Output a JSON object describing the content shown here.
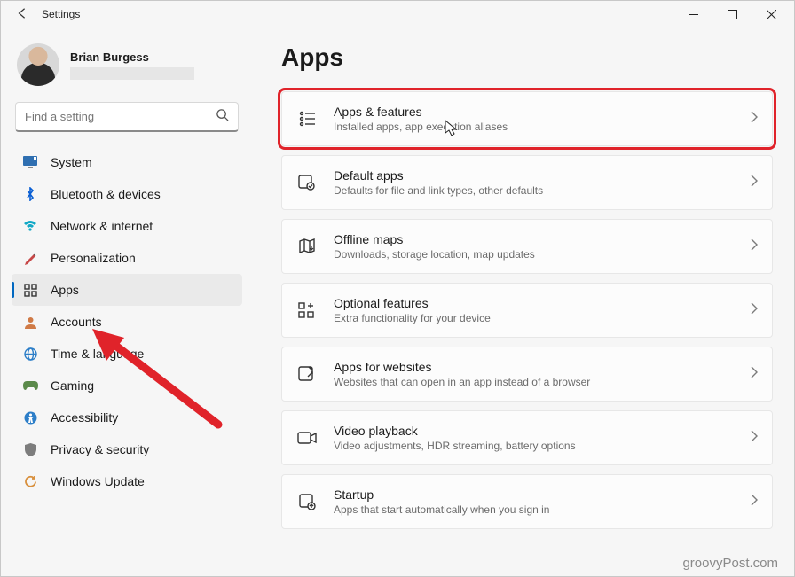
{
  "window": {
    "title": "Settings"
  },
  "profile": {
    "name": "Brian Burgess"
  },
  "search": {
    "placeholder": "Find a setting"
  },
  "sidebar": {
    "items": [
      {
        "label": "System"
      },
      {
        "label": "Bluetooth & devices"
      },
      {
        "label": "Network & internet"
      },
      {
        "label": "Personalization"
      },
      {
        "label": "Apps"
      },
      {
        "label": "Accounts"
      },
      {
        "label": "Time & language"
      },
      {
        "label": "Gaming"
      },
      {
        "label": "Accessibility"
      },
      {
        "label": "Privacy & security"
      },
      {
        "label": "Windows Update"
      }
    ]
  },
  "main": {
    "heading": "Apps",
    "cards": [
      {
        "title": "Apps & features",
        "subtitle": "Installed apps, app execution aliases"
      },
      {
        "title": "Default apps",
        "subtitle": "Defaults for file and link types, other defaults"
      },
      {
        "title": "Offline maps",
        "subtitle": "Downloads, storage location, map updates"
      },
      {
        "title": "Optional features",
        "subtitle": "Extra functionality for your device"
      },
      {
        "title": "Apps for websites",
        "subtitle": "Websites that can open in an app instead of a browser"
      },
      {
        "title": "Video playback",
        "subtitle": "Video adjustments, HDR streaming, battery options"
      },
      {
        "title": "Startup",
        "subtitle": "Apps that start automatically when you sign in"
      }
    ]
  },
  "watermark": "groovyPost.com"
}
